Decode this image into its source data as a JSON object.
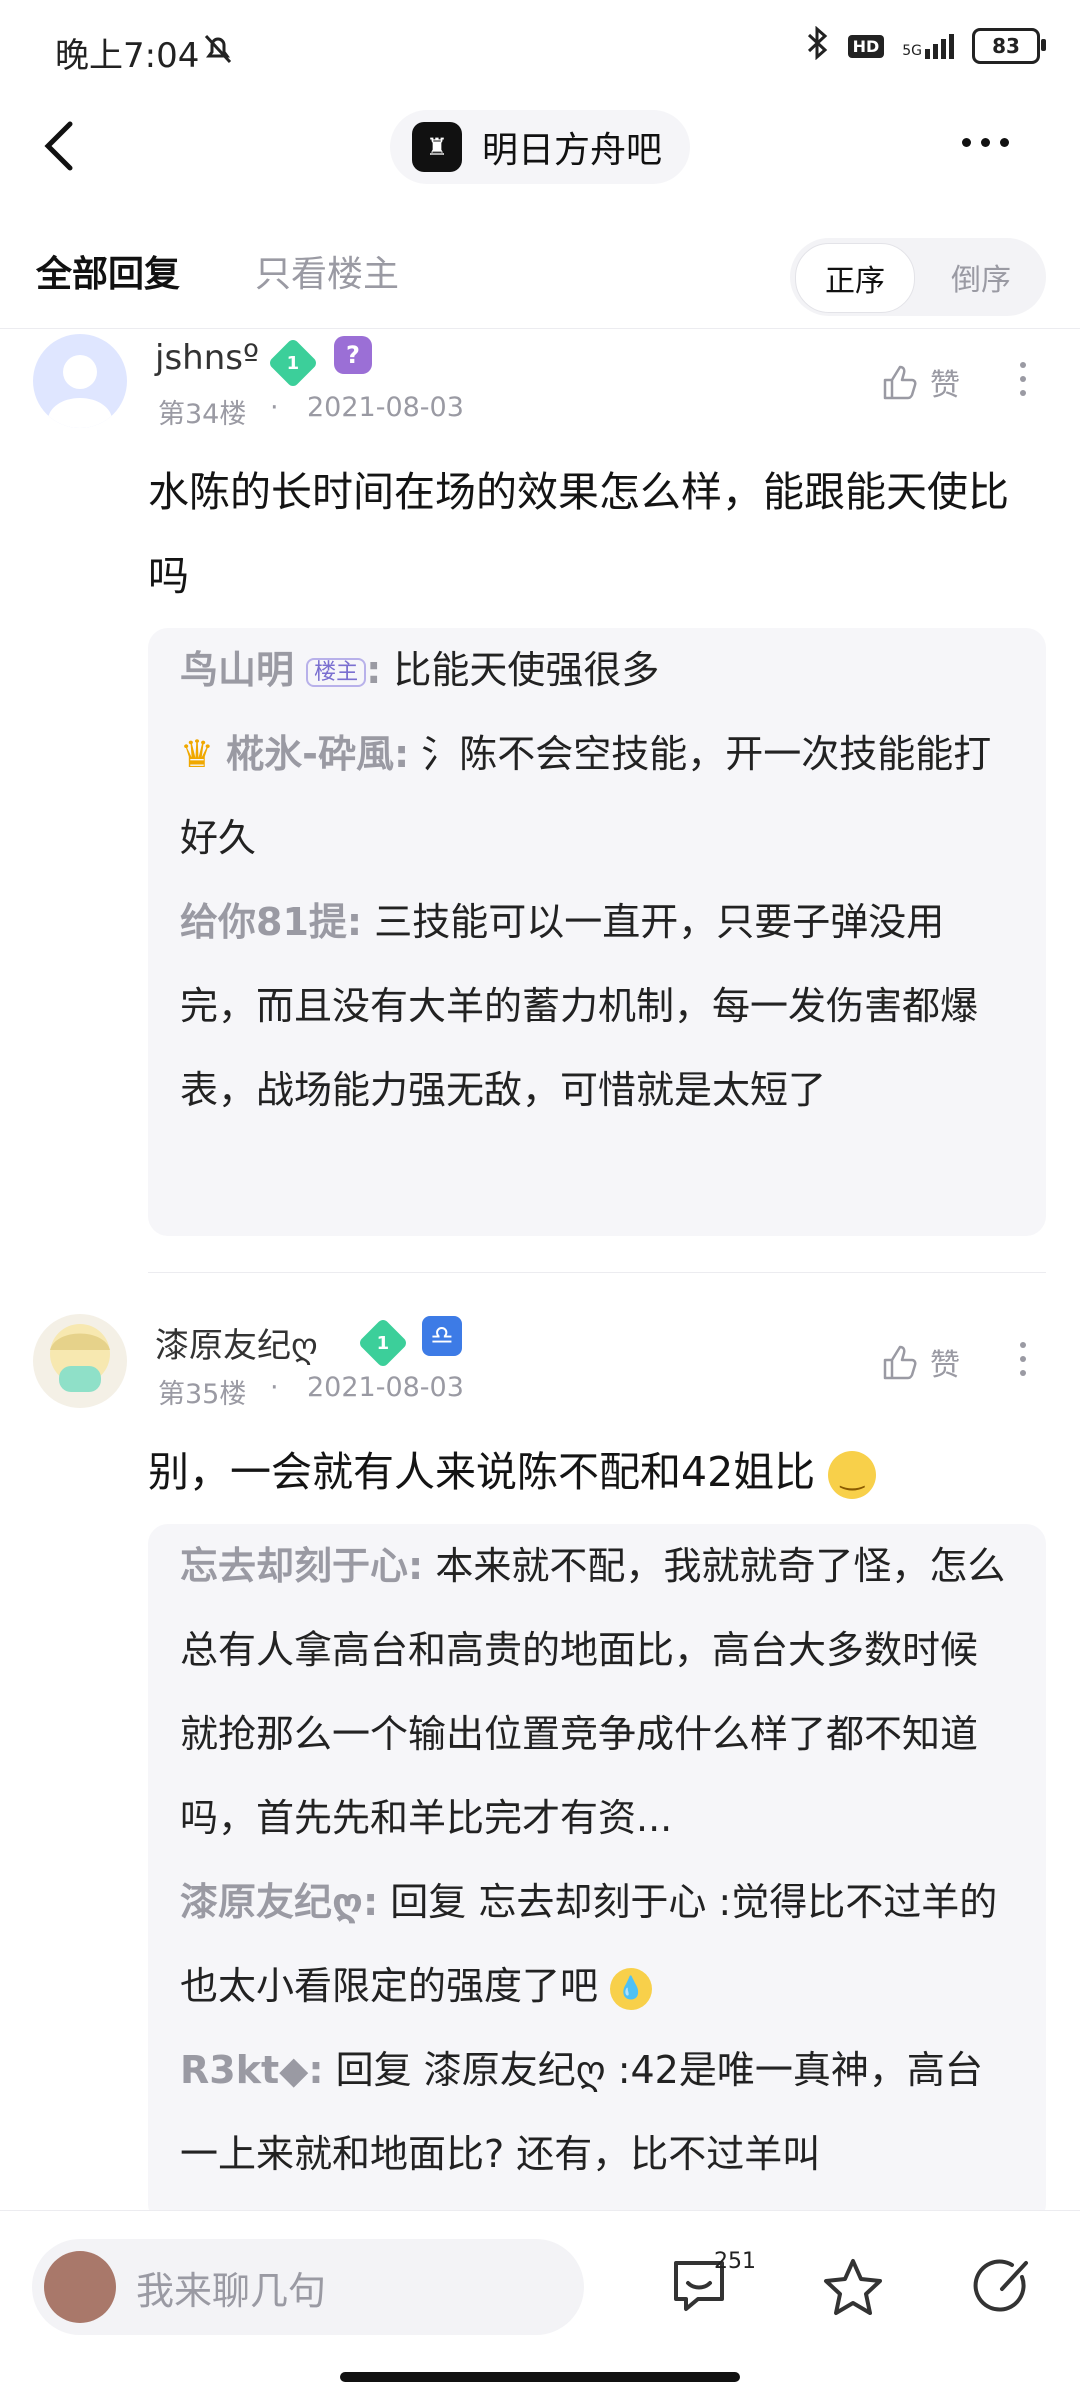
{
  "status_bar": {
    "time": "晚上7:04",
    "network": "5G",
    "hd": "HD",
    "battery": "83"
  },
  "nav": {
    "forum_name": "明日方舟吧"
  },
  "tabs": {
    "all": "全部回复",
    "op_only": "只看楼主",
    "sort_asc": "正序",
    "sort_desc": "倒序"
  },
  "posts": [
    {
      "username": "jshnsº",
      "level": "1",
      "floor": "第34楼",
      "date": "2021-08-03",
      "like_label": "赞",
      "text": "水陈的长时间在场的效果怎么样，能跟能天使比吗",
      "replies": [
        {
          "name": "鸟山明",
          "op_badge": "楼主",
          "text": "比能天使强很多"
        },
        {
          "name": "椛氷-砕風",
          "text": "氵陈不会空技能，开一次技能能打好久"
        },
        {
          "name": "给你81提",
          "text": "三技能可以一直开，只要子弹没用完，而且没有大羊的蓄力机制，每一发伤害都爆表，战场能力强无敌，可惜就是太短了"
        }
      ]
    },
    {
      "username": "漆原友纪ღ",
      "level": "1",
      "floor": "第35楼",
      "date": "2021-08-03",
      "like_label": "赞",
      "text": "别，一会就有人来说陈不配和42姐比",
      "replies": [
        {
          "name": "忘去却刻于心",
          "text": "本来就不配，我就就奇了怪，怎么总有人拿高台和高贵的地面比，高台大多数时候就抢那么一个输出位置竞争成什么样了都不知道吗，首先先和羊比完才有资..."
        },
        {
          "name": "漆原友纪ღ",
          "text": "回复 忘去却刻于心 :觉得比不过羊的也太小看限定的强度了吧"
        },
        {
          "name": "R3kt◆",
          "text": "回复 漆原友纪ღ :42是唯一真神，高台一上来就和地面比? 还有，比不过羊叫"
        }
      ]
    }
  ],
  "bottom": {
    "placeholder": "我来聊几句",
    "comment_count": "251"
  }
}
